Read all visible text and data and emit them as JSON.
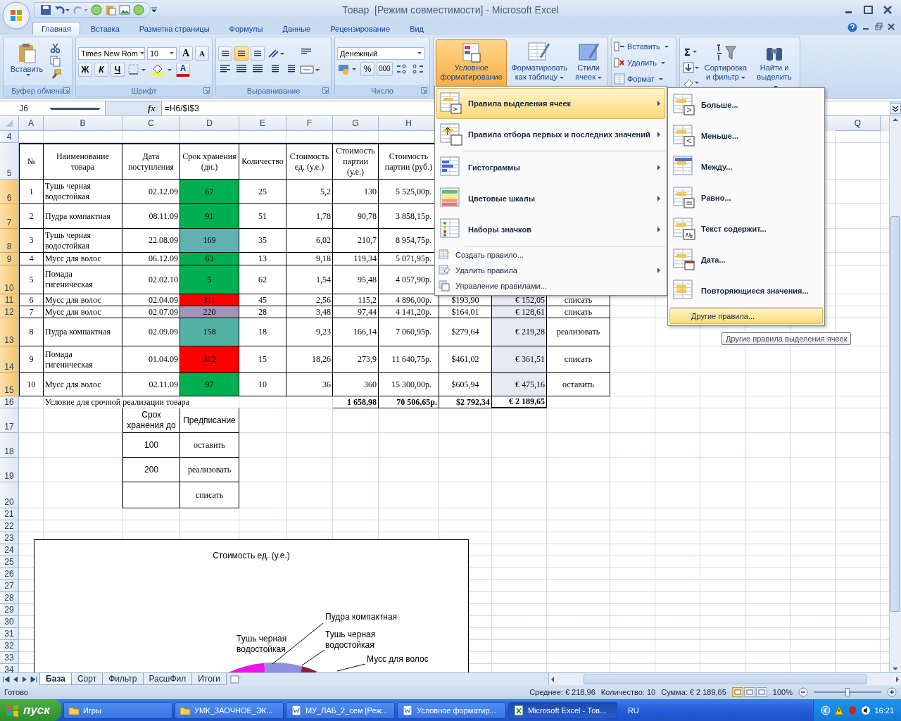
{
  "window": {
    "title": "Товар  [Режим совместимости] - Microsoft Excel"
  },
  "ribbon": {
    "tabs": [
      {
        "label": "Главная",
        "selected": true
      },
      {
        "label": "Вставка",
        "selected": false
      },
      {
        "label": "Разметка страницы",
        "selected": false
      },
      {
        "label": "Формулы",
        "selected": false
      },
      {
        "label": "Данные",
        "selected": false
      },
      {
        "label": "Рецензирование",
        "selected": false
      },
      {
        "label": "Вид",
        "selected": false
      }
    ],
    "clipboard": {
      "label": "Буфер обмена",
      "paste": "Вставить"
    },
    "font": {
      "label": "Шрифт",
      "name": "Times New Rom",
      "size": "10",
      "grow": "A",
      "shrink": "A",
      "bold": "Ж",
      "italic": "К",
      "underline": "Ч",
      "color_letter": "A"
    },
    "alignment": {
      "label": "Выравнивание",
      "vertical": [
        {
          "selected": false
        },
        {
          "selected": true
        },
        {
          "selected": false
        }
      ]
    },
    "number": {
      "label": "Число",
      "format": "Денежный",
      "percent": "%",
      "thousands": "000"
    },
    "styles": {
      "conditional": {
        "label": "Условное форматирование",
        "selected": true
      },
      "format_table": "Форматировать как таблицу",
      "cell_styles": "Стили ячеек"
    },
    "cells": {
      "insert": "Вставить",
      "delete": "Удалить",
      "format": "Формат"
    },
    "editing": {
      "sum": "Σ",
      "sort": "Сортировка и фильтр",
      "find": "Найти и выделить"
    }
  },
  "formula_bar": {
    "name_box": "J6",
    "function_label": "fx",
    "formula": "=H6/$I$3"
  },
  "sheet": {
    "column_headers": [
      "A",
      "B",
      "C",
      "D",
      "E",
      "F",
      "G",
      "H"
    ],
    "column_headers_right": [
      "Q"
    ],
    "rows": [
      {
        "header": "4",
        "kind": "blank",
        "selected": false
      },
      {
        "header": "5",
        "kind": "header",
        "selected": false,
        "cells": {
          "A": "№",
          "B": "Наименование товара",
          "C": "Дата поступления",
          "D": "Срок хранения (дн.)",
          "E": "Количество",
          "F": "Стоимость ед. (у.е.)",
          "G": "Стоимость партии (у.е.)",
          "H": "Стоимость партии (руб.)"
        }
      },
      {
        "header": "6",
        "kind": "item",
        "selected": true,
        "cells": {
          "A": "1",
          "B": "Тушь черная водостойкая",
          "C": "02.12.09",
          "D": {
            "text": "67",
            "color": "#00b050"
          },
          "E": "25",
          "F": "5,2",
          "G": "130",
          "H": "5 525,00р."
        }
      },
      {
        "header": "7",
        "kind": "item",
        "selected": true,
        "cells": {
          "A": "2",
          "B": "Пудра компактная",
          "C": "08.11.09",
          "D": {
            "text": "91",
            "color": "#00b050"
          },
          "E": "51",
          "F": "1,78",
          "G": "90,78",
          "H": "3 858,15р."
        }
      },
      {
        "header": "8",
        "kind": "item",
        "selected": true,
        "cells": {
          "A": "3",
          "B": "Тушь черная водостойкая",
          "C": "22.08.09",
          "D": {
            "text": "169",
            "color": "#63b1b4"
          },
          "E": "35",
          "F": "6,02",
          "G": "210,7",
          "H": "8 954,75р."
        }
      },
      {
        "header": "9",
        "kind": "item",
        "selected": true,
        "cells": {
          "A": "4",
          "B": "Мусс для волос",
          "C": "06.12.09",
          "D": {
            "text": "63",
            "color": "#00b050"
          },
          "E": "13",
          "F": "9,18",
          "G": "119,34",
          "H": "5 071,95р."
        }
      },
      {
        "header": "10",
        "kind": "item",
        "selected": true,
        "cells": {
          "A": "5",
          "B": "Помада гигеническая",
          "C": "02.02.10",
          "D": {
            "text": "5",
            "color": "#00b050"
          },
          "E": "62",
          "F": "1,54",
          "G": "95,48",
          "H": "4 057,90р."
        }
      },
      {
        "header": "11",
        "kind": "item",
        "selected": true,
        "cells": {
          "A": "6",
          "B": "Мусс для волос",
          "C": "02.04.09",
          "D": {
            "text": "311",
            "color": "#ff0000"
          },
          "E": "45",
          "F": "2,56",
          "G": "115,2",
          "H": "4 896,00р.",
          "I": "$193,90",
          "J": "€ 152,05",
          "K": "списать"
        }
      },
      {
        "header": "12",
        "kind": "item",
        "selected": true,
        "cells": {
          "A": "7",
          "B": "Мусс для волос",
          "C": "02.07.09",
          "D": {
            "text": "220",
            "color": "#a295b9"
          },
          "E": "28",
          "F": "3,48",
          "G": "97,44",
          "H": "4 141,20р.",
          "I": "$164,01",
          "J": "€ 128,61",
          "K": "списать"
        }
      },
      {
        "header": "13",
        "kind": "item",
        "selected": true,
        "cells": {
          "A": "8",
          "B": "Пудра компактная",
          "C": "02.09.09",
          "D": {
            "text": "158",
            "color": "#52b2a4"
          },
          "E": "18",
          "F": "9,23",
          "G": "166,14",
          "H": "7 060,95р.",
          "I": "$279,64",
          "J": "€ 219,28",
          "K": "реализовать"
        }
      },
      {
        "header": "14",
        "kind": "item",
        "selected": true,
        "cells": {
          "A": "9",
          "B": "Помада гигеническая",
          "C": "01.04.09",
          "D": {
            "text": "312",
            "color": "#ff0000"
          },
          "E": "15",
          "F": "18,26",
          "G": "273,9",
          "H": "11 640,75р.",
          "I": "$461,02",
          "J": "€ 361,51",
          "K": "списать"
        }
      },
      {
        "header": "15",
        "kind": "item",
        "selected": true,
        "cells": {
          "A": "10",
          "B": "Мусс для волос",
          "C": "02.11.09",
          "D": {
            "text": "97",
            "color": "#00b050"
          },
          "E": "10",
          "F": "36",
          "G": "360",
          "H": "15 300,00р.",
          "I": "$605,94",
          "J": "€ 475,16",
          "K": "оставить"
        }
      },
      {
        "header": "16",
        "kind": "total",
        "selected": false,
        "cells": {
          "B": "Условие для срочной реализации товара",
          "G": "1 658,98",
          "H": "70 506,65р.",
          "I": "$2 792,34",
          "J": "€ 2 189,65"
        }
      },
      {
        "header": "17",
        "kind": "lookup",
        "selected": false,
        "cells": {
          "C": "Срок хранения до",
          "D": "Предписание"
        }
      },
      {
        "header": "18",
        "kind": "lookup",
        "selected": false,
        "cells": {
          "C": "100",
          "D": "оставить"
        }
      },
      {
        "header": "19",
        "kind": "lookup",
        "selected": false,
        "cells": {
          "C": "200",
          "D": "реализовать"
        }
      },
      {
        "header": "20",
        "kind": "lookup",
        "selected": false,
        "cells": {
          "D": "списать"
        }
      },
      {
        "header": "21",
        "kind": "blank",
        "selected": false
      },
      {
        "header": "22",
        "kind": "blank",
        "selected": false
      },
      {
        "header": "23",
        "kind": "blank",
        "selected": false
      },
      {
        "header": "24",
        "kind": "blank",
        "selected": false
      },
      {
        "header": "25",
        "kind": "blank",
        "selected": false
      },
      {
        "header": "26",
        "kind": "blank",
        "selected": false
      },
      {
        "header": "27",
        "kind": "blank",
        "selected": false
      },
      {
        "header": "28",
        "kind": "blank",
        "selected": false
      },
      {
        "header": "29",
        "kind": "blank",
        "selected": false
      },
      {
        "header": "30",
        "kind": "blank",
        "selected": false
      },
      {
        "header": "31",
        "kind": "blank",
        "selected": false
      },
      {
        "header": "32",
        "kind": "blank",
        "selected": false
      },
      {
        "header": "33",
        "kind": "blank",
        "selected": false
      },
      {
        "header": "34",
        "kind": "blank",
        "selected": false
      }
    ],
    "chart": {
      "title": "Стоимость ед. (у.е.)",
      "labels": [
        "Пудра компактная",
        "Тушь черная водостойкая",
        "Тушь черная водостойкая",
        "Мусс для волос"
      ]
    }
  },
  "menu": {
    "items": [
      {
        "kind": "rule",
        "label": "Правила выделения ячеек",
        "selected": true,
        "submenu": true
      },
      {
        "kind": "rule",
        "label": "Правила отбора первых и последних значений",
        "selected": false,
        "submenu": true
      },
      {
        "kind": "visual",
        "label": "Гистограммы",
        "selected": false,
        "submenu": true
      },
      {
        "kind": "visual",
        "label": "Цветовые шкалы",
        "selected": false,
        "submenu": true
      },
      {
        "kind": "visual",
        "label": "Наборы значков",
        "selected": false,
        "submenu": true
      },
      {
        "kind": "command",
        "label": "Создать правило...",
        "selected": false,
        "submenu": false
      },
      {
        "kind": "command",
        "label": "Удалить правила",
        "selected": false,
        "submenu": true
      },
      {
        "kind": "command",
        "label": "Управление правилами...",
        "selected": false,
        "submenu": false
      }
    ]
  },
  "submenu": {
    "items": [
      {
        "kind": "rule",
        "label": "Больше...",
        "selected": false
      },
      {
        "kind": "rule",
        "label": "Меньше...",
        "selected": false
      },
      {
        "kind": "rule",
        "label": "Между...",
        "selected": false
      },
      {
        "kind": "rule",
        "label": "Равно...",
        "selected": false
      },
      {
        "kind": "rule",
        "label": "Текст содержит...",
        "selected": false
      },
      {
        "kind": "rule",
        "label": "Дата...",
        "selected": false
      },
      {
        "kind": "rule",
        "label": "Повторяющиеся значения...",
        "selected": false
      },
      {
        "kind": "command",
        "label": "Другие правила...",
        "selected": true
      }
    ]
  },
  "tooltip": "Другие правила выделения ячеек",
  "sheet_tabs": [
    {
      "label": "База",
      "selected": true
    },
    {
      "label": "Сорт",
      "selected": false
    },
    {
      "label": "Фильтр",
      "selected": false
    },
    {
      "label": "РасшФил",
      "selected": false
    },
    {
      "label": "Итоги",
      "selected": false
    }
  ],
  "status_bar": {
    "state": "Готово",
    "average": "Среднее: € 218,96",
    "count": "Количество: 10",
    "sum": "Сумма: € 2 189,65",
    "views": [
      {
        "selected": true
      },
      {
        "selected": false
      },
      {
        "selected": false
      }
    ],
    "zoom": "100%",
    "level": 0.5
  },
  "taskbar": {
    "start": "пуск",
    "tasks": [
      {
        "kind": "folder",
        "label": "Игры",
        "selected": false
      },
      {
        "kind": "folder",
        "label": "УМК_ЗАОЧНОЕ_ЭК...",
        "selected": false
      },
      {
        "kind": "word",
        "label": "МУ_ЛАБ_2_сем [Реж...",
        "selected": false
      },
      {
        "kind": "word",
        "label": "Условное форматир...",
        "selected": false
      },
      {
        "kind": "excel",
        "label": "Microsoft Excel - Тов...",
        "selected": true
      }
    ],
    "language": "RU",
    "time": "16:21"
  }
}
